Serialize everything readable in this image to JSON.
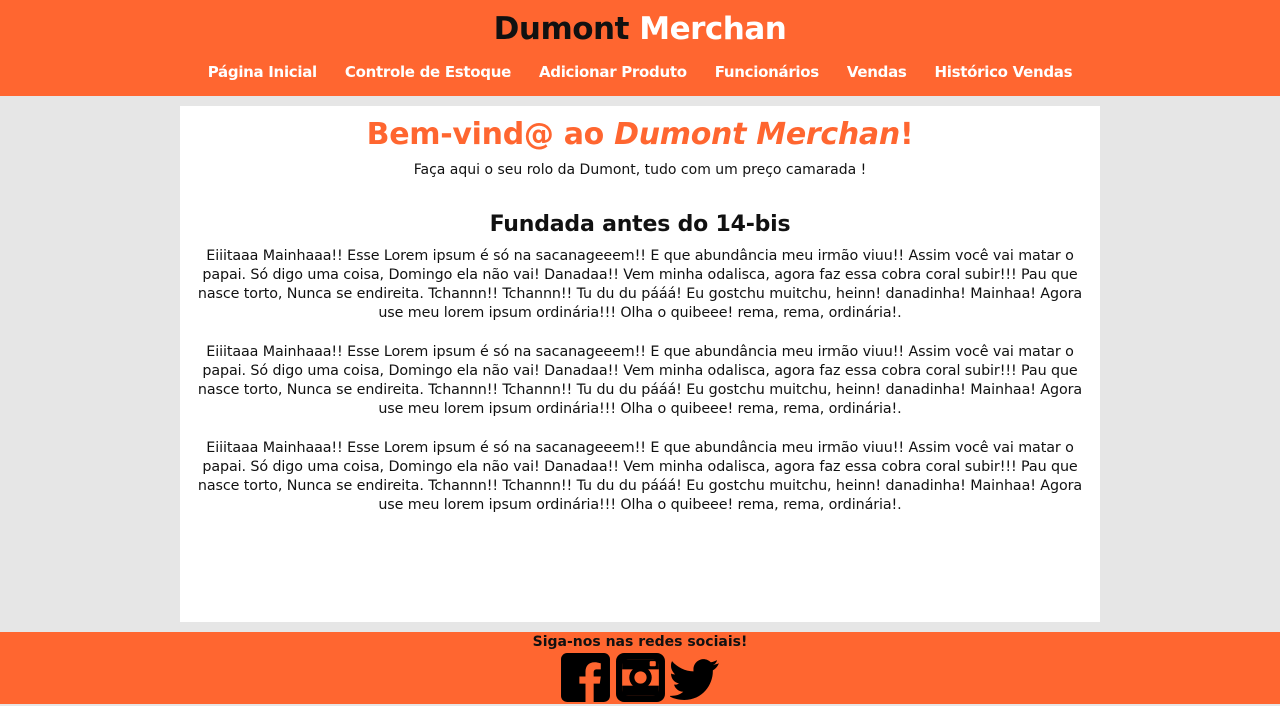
{
  "header": {
    "brand_part1": "Dumont",
    "brand_part2": "Merchan",
    "nav": [
      {
        "label": "Página Inicial"
      },
      {
        "label": "Controle de Estoque"
      },
      {
        "label": "Adicionar Produto"
      },
      {
        "label": "Funcionários"
      },
      {
        "label": "Vendas"
      },
      {
        "label": "Histórico Vendas"
      }
    ]
  },
  "main": {
    "welcome_prefix": "Bem-vind@ ao",
    "welcome_brand": "Dumont Merchan",
    "welcome_suffix": "!",
    "tagline": "Faça aqui o seu rolo da Dumont, tudo com um preço camarada !",
    "section_title": "Fundada antes do 14-bis",
    "paragraphs": [
      "Eiiitaaa Mainhaaa!! Esse Lorem ipsum é só na sacanageeem!! E que abundância meu irmão viuu!! Assim você vai matar o papai. Só digo uma coisa, Domingo ela não vai! Danadaa!! Vem minha odalisca, agora faz essa cobra coral subir!!! Pau que nasce torto, Nunca se endireita. Tchannn!! Tchannn!! Tu du du pááá! Eu gostchu muitchu, heinn! danadinha! Mainhaa! Agora use meu lorem ipsum ordinária!!! Olha o quibeee! rema, rema, ordinária!.",
      "Eiiitaaa Mainhaaa!! Esse Lorem ipsum é só na sacanageeem!! E que abundância meu irmão viuu!! Assim você vai matar o papai. Só digo uma coisa, Domingo ela não vai! Danadaa!! Vem minha odalisca, agora faz essa cobra coral subir!!! Pau que nasce torto, Nunca se endireita. Tchannn!! Tchannn!! Tu du du pááá! Eu gostchu muitchu, heinn! danadinha! Mainhaa! Agora use meu lorem ipsum ordinária!!! Olha o quibeee! rema, rema, ordinária!.",
      "Eiiitaaa Mainhaaa!! Esse Lorem ipsum é só na sacanageeem!! E que abundância meu irmão viuu!! Assim você vai matar o papai. Só digo uma coisa, Domingo ela não vai! Danadaa!! Vem minha odalisca, agora faz essa cobra coral subir!!! Pau que nasce torto, Nunca se endireita. Tchannn!! Tchannn!! Tu du du pááá! Eu gostchu muitchu, heinn! danadinha! Mainhaa! Agora use meu lorem ipsum ordinária!!! Olha o quibeee! rema, rema, ordinária!."
    ]
  },
  "footer": {
    "follow_text": "Siga-nos nas redes sociais!",
    "socials": [
      {
        "icon": "facebook-icon"
      },
      {
        "icon": "instagram-icon"
      },
      {
        "icon": "twitter-icon"
      }
    ]
  },
  "colors": {
    "accent": "#ff6630",
    "background": "#e6e6e6",
    "panel": "#ffffff",
    "text": "#111111"
  }
}
